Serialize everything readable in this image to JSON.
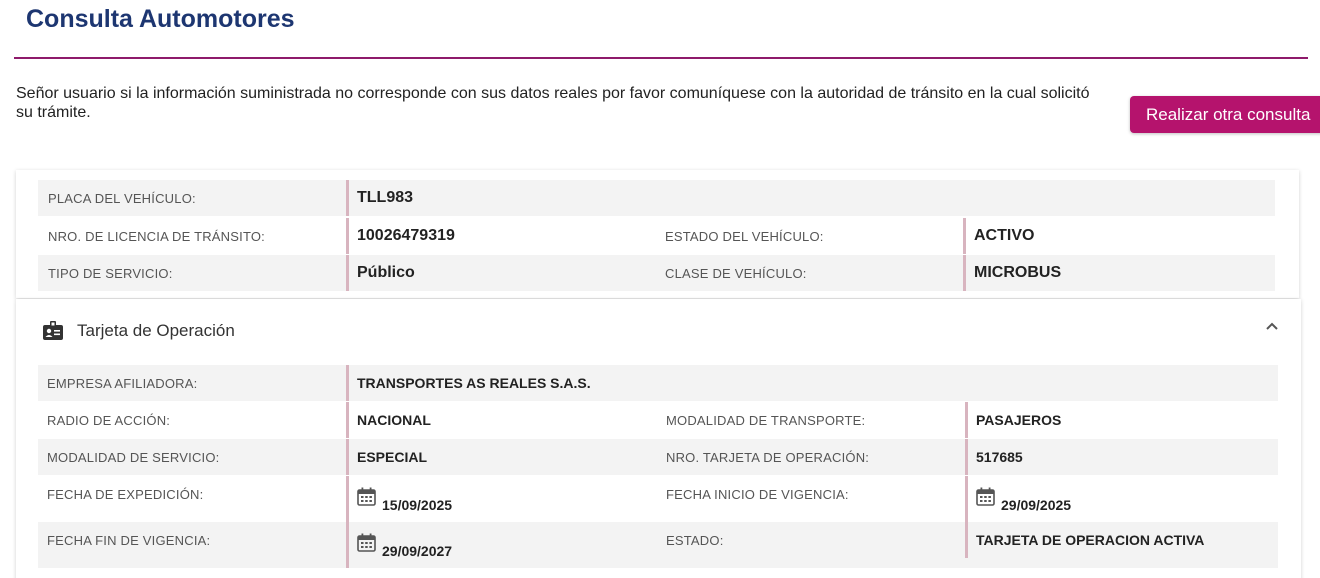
{
  "page": {
    "title": "Consulta Automotores",
    "notice": "Señor usuario si la información suministrada no corresponde con sus datos reales por favor comuníquese con la autoridad de tránsito en la cual solicitó su trámite.",
    "action_button": "Realizar otra consulta",
    "accent_color": "#b5136d",
    "title_color": "#1d3671"
  },
  "vehicle": {
    "plate_label": "PLACA DEL VEHÍCULO:",
    "plate_value": "TLL983",
    "license_label": "NRO. DE LICENCIA DE TRÁNSITO:",
    "license_value": "10026479319",
    "status_label": "ESTADO DEL VEHÍCULO:",
    "status_value": "ACTIVO",
    "service_label": "TIPO DE SERVICIO:",
    "service_value": "Público",
    "class_label": "CLASE DE VEHÍCULO:",
    "class_value": "MICROBUS"
  },
  "operation_card": {
    "title": "Tarjeta de Operación",
    "header_icon": "id-card-icon",
    "collapse_icon": "chevron-up-icon",
    "company_label": "EMPRESA AFILIADORA:",
    "company_value": "TRANSPORTES AS REALES S.A.S.",
    "radius_label": "RADIO DE ACCIÓN:",
    "radius_value": "NACIONAL",
    "transport_mode_label": "MODALIDAD DE TRANSPORTE:",
    "transport_mode_value": "PASAJEROS",
    "service_mode_label": "MODALIDAD DE SERVICIO:",
    "service_mode_value": "ESPECIAL",
    "card_number_label": "NRO. TARJETA DE OPERACIÓN:",
    "card_number_value": "517685",
    "issue_date_label": "FECHA DE EXPEDICIÓN:",
    "issue_date_value": "15/09/2025",
    "start_date_label": "FECHA INICIO DE VIGENCIA:",
    "start_date_value": "29/09/2025",
    "end_date_label": "FECHA FIN DE VIGENCIA:",
    "end_date_value": "29/09/2027",
    "state_label": "ESTADO:",
    "state_value": "TARJETA DE OPERACION ACTIVA"
  }
}
